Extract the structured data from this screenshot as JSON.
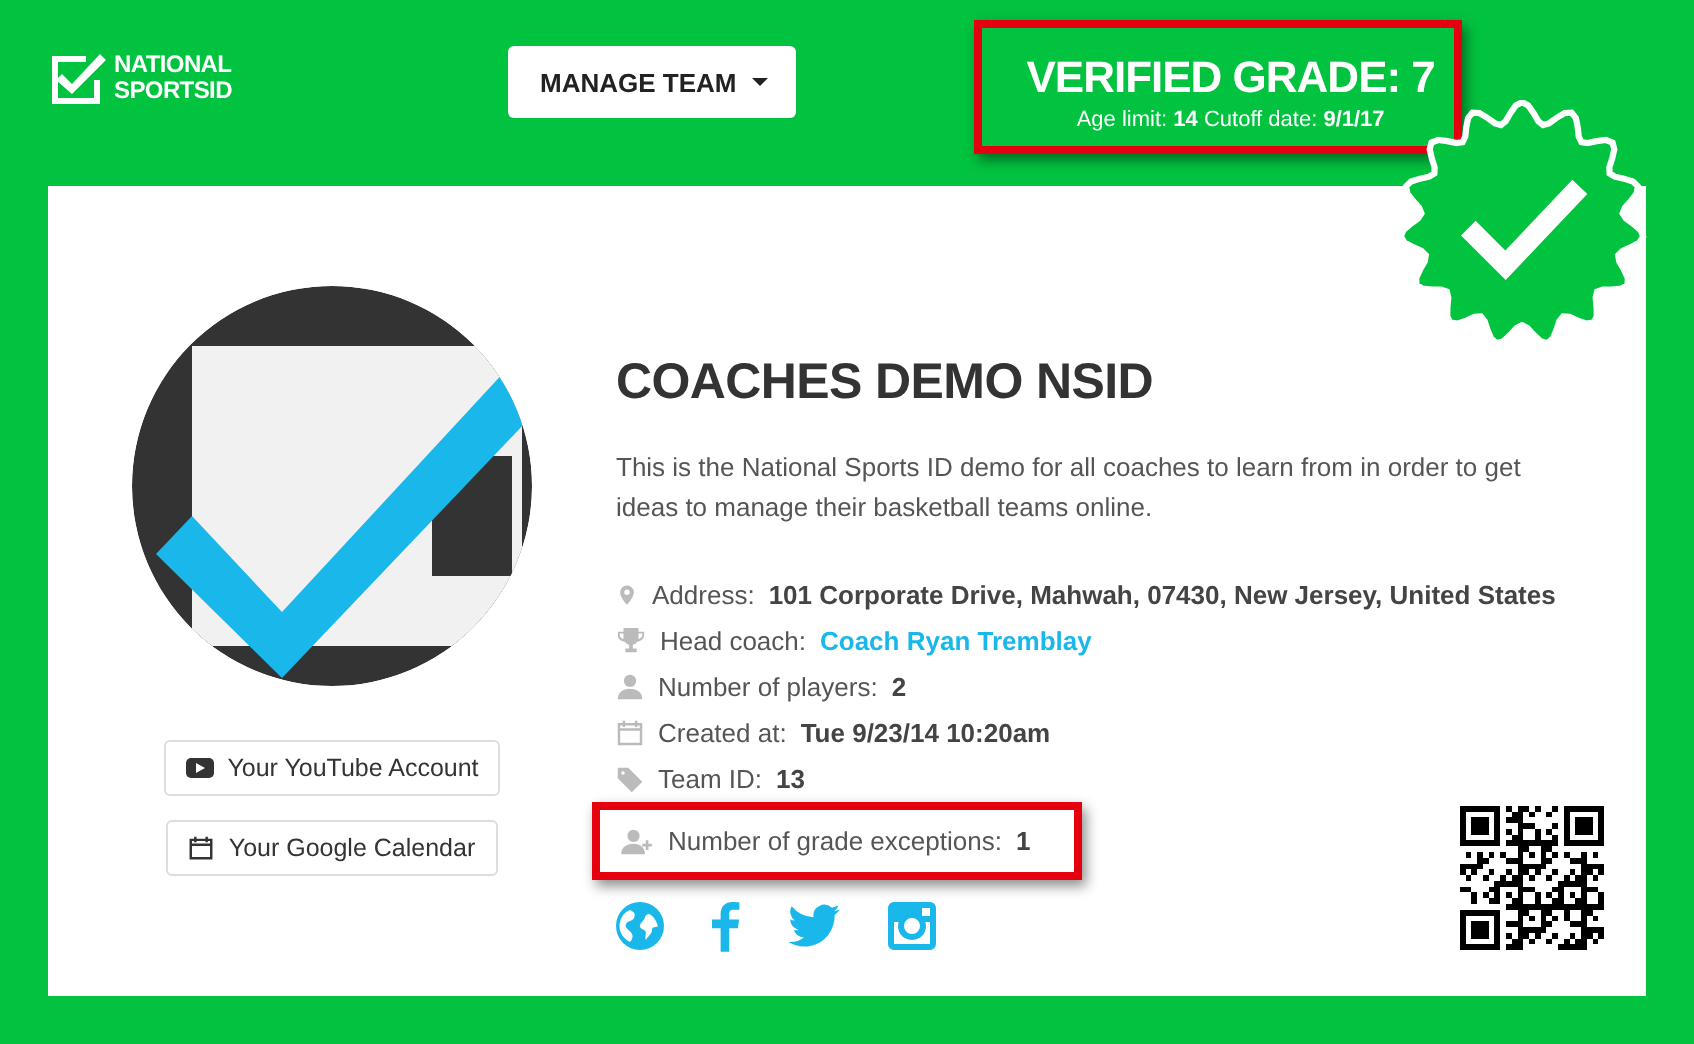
{
  "logo": {
    "line_1": "NATIONAL",
    "line_2": "SPORTSID"
  },
  "manage_button": {
    "label": "MANAGE TEAM"
  },
  "grade": {
    "title": "VERIFIED GRADE: 7",
    "age_label": "Age limit:",
    "age_value": "14",
    "cutoff_label": "Cutoff date:",
    "cutoff_value": "9/1/17",
    "highlighted": true
  },
  "verified_badge": {
    "verified": true
  },
  "profile_buttons": [
    {
      "kind": "youtube",
      "label": "Your YouTube Account"
    },
    {
      "kind": "calendar",
      "label": "Your Google Calendar"
    }
  ],
  "team": {
    "name": "COACHES DEMO NSID",
    "description": "This is the National Sports ID demo for all coaches to learn from in order to get ideas to manage their basketball teams online."
  },
  "info_rows": [
    {
      "kind": "pin",
      "label": "Address:",
      "value": "101 Corporate Drive, Mahwah, 07430, New Jersey, United States",
      "link": false,
      "highlighted": false
    },
    {
      "kind": "trophy",
      "label": "Head coach:",
      "value": "Coach Ryan Tremblay",
      "link": true,
      "highlighted": false
    },
    {
      "kind": "user",
      "label": "Number of players:",
      "value": "2",
      "link": false,
      "highlighted": false
    },
    {
      "kind": "calendar",
      "label": "Created at:",
      "value": "Tue 9/23/14 10:20am",
      "link": false,
      "highlighted": false
    },
    {
      "kind": "tag",
      "label": "Team ID:",
      "value": "13",
      "link": false,
      "highlighted": false
    },
    {
      "kind": "user-plus",
      "label": "Number of grade exceptions:",
      "value": "1",
      "link": false,
      "highlighted": true
    }
  ],
  "social_links": [
    {
      "kind": "globe"
    },
    {
      "kind": "facebook"
    },
    {
      "kind": "twitter"
    },
    {
      "kind": "instagram"
    }
  ]
}
